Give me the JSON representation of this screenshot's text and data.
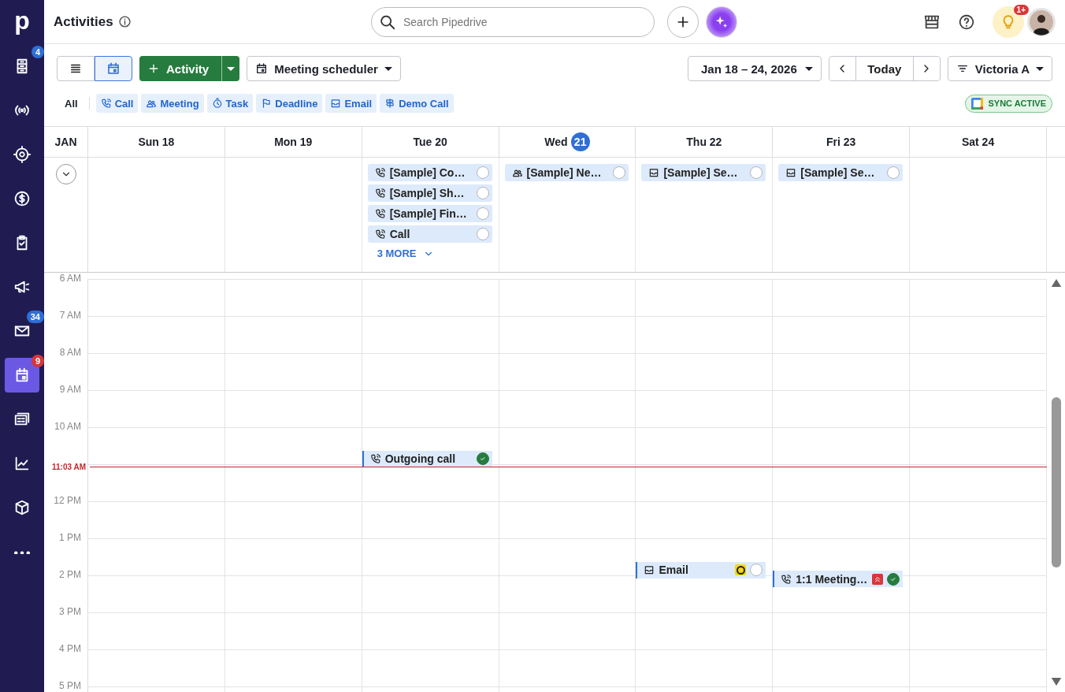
{
  "sidebar": {
    "logo": "p",
    "items": [
      {
        "kind": "leads",
        "badge": "4",
        "color": "#2f6fd6",
        "selected": false
      },
      {
        "kind": "broadcast",
        "selected": false
      },
      {
        "kind": "target",
        "selected": false
      },
      {
        "kind": "deals",
        "selected": false
      },
      {
        "kind": "projects",
        "selected": false
      },
      {
        "kind": "campaigns",
        "selected": false
      },
      {
        "kind": "mail",
        "badge": "34",
        "color": "#2f6fd6",
        "selected": false
      },
      {
        "kind": "activities",
        "badge": "9",
        "color": "#d8363a",
        "selected": true
      },
      {
        "kind": "contacts",
        "selected": false
      },
      {
        "kind": "insights",
        "selected": false
      },
      {
        "kind": "products",
        "selected": false
      },
      {
        "kind": "more",
        "selected": false
      }
    ]
  },
  "topbar": {
    "title": "Activities",
    "search": {
      "placeholder": "Search Pipedrive"
    },
    "tips_badge": "1+"
  },
  "toolbar": {
    "views": [
      {
        "kind": "list",
        "selected": false
      },
      {
        "kind": "calendar",
        "selected": true
      }
    ],
    "add_button": "Activity",
    "scheduler_button": "Meeting scheduler",
    "date_range": "Jan 18 – 24, 2026",
    "today_button": "Today",
    "user_filter": "Victoria A"
  },
  "filters": [
    {
      "kind": "all",
      "label": "All",
      "selected": false
    },
    {
      "kind": "call",
      "label": "Call",
      "selected": true
    },
    {
      "kind": "meeting",
      "label": "Meeting",
      "selected": true
    },
    {
      "kind": "task",
      "label": "Task",
      "selected": true
    },
    {
      "kind": "deadline",
      "label": "Deadline",
      "selected": true
    },
    {
      "kind": "email",
      "label": "Email",
      "selected": true
    },
    {
      "kind": "demo",
      "label": "Demo Call",
      "selected": true
    }
  ],
  "sync_badge": "SYNC ACTIVE",
  "calendar": {
    "month": "JAN",
    "days": [
      {
        "name": "Sun",
        "date": "18",
        "today": false
      },
      {
        "name": "Mon",
        "date": "19",
        "today": false
      },
      {
        "name": "Tue",
        "date": "20",
        "today": false,
        "all_day": [
          {
            "kind": "call",
            "title": "[Sample] Co…",
            "done": false
          },
          {
            "kind": "call",
            "title": "[Sample] Sh…",
            "done": false
          },
          {
            "kind": "call",
            "title": "[Sample] Fin…",
            "done": false
          },
          {
            "kind": "call",
            "title": "Call",
            "done": false
          }
        ],
        "more": "3 MORE",
        "events": [
          {
            "kind": "call",
            "title": "Outgoing call",
            "time": {
              "kind": "t1030"
            },
            "done": true
          }
        ]
      },
      {
        "name": "Wed",
        "date": "21",
        "today": true,
        "all_day": [
          {
            "kind": "meeting",
            "title": "[Sample] Ne…",
            "done": false
          }
        ]
      },
      {
        "name": "Thu",
        "date": "22",
        "today": false,
        "all_day": [
          {
            "kind": "email",
            "title": "[Sample] Se…",
            "done": false
          }
        ],
        "events": [
          {
            "kind": "email",
            "title": "Email",
            "time": {
              "kind": "t1330"
            },
            "done": false,
            "color": "#f5d80f"
          }
        ]
      },
      {
        "name": "Fri",
        "date": "23",
        "today": false,
        "all_day": [
          {
            "kind": "email",
            "title": "[Sample] Se…",
            "done": false
          }
        ],
        "events": [
          {
            "kind": "call",
            "title": "1:1 Meeting…",
            "time": {
              "kind": "t1345"
            },
            "done": true,
            "high_priority": true
          }
        ]
      },
      {
        "name": "Sat",
        "date": "24",
        "today": false
      }
    ],
    "hours": [
      {
        "kind": "hour",
        "label": "6 AM"
      },
      {
        "kind": "hour",
        "label": "7 AM"
      },
      {
        "kind": "hour",
        "label": "8 AM"
      },
      {
        "kind": "hour",
        "label": "9 AM"
      },
      {
        "kind": "hour",
        "label": "10 AM"
      },
      {
        "kind": "now",
        "label": "11:03 AM"
      },
      {
        "kind": "hour",
        "label": "12 PM"
      },
      {
        "kind": "hour",
        "label": "1 PM"
      },
      {
        "kind": "hour",
        "label": "2 PM"
      },
      {
        "kind": "hour",
        "label": "3 PM"
      },
      {
        "kind": "hour",
        "label": "4 PM"
      },
      {
        "kind": "hour",
        "label": "5 PM"
      }
    ]
  }
}
